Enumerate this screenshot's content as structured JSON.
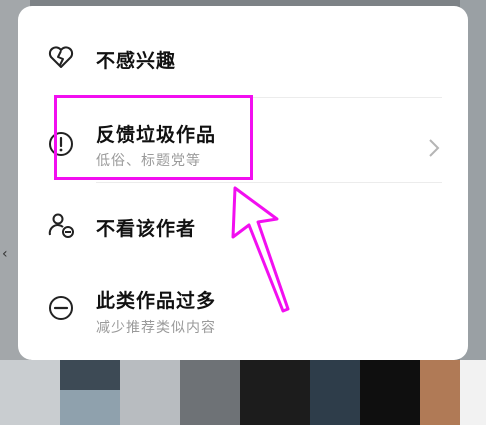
{
  "menu": {
    "items": [
      {
        "title": "不感兴趣",
        "icon": "broken-heart-icon"
      },
      {
        "title": "反馈垃圾作品",
        "subtitle": "低俗、标题党等",
        "icon": "exclamation-circle-icon",
        "has_chevron": true
      },
      {
        "title": "不看该作者",
        "icon": "user-minus-icon"
      },
      {
        "title": "此类作品过多",
        "subtitle": "减少推荐类似内容",
        "icon": "minus-circle-icon"
      }
    ]
  },
  "annotation": {
    "color": "#f20ff0"
  }
}
